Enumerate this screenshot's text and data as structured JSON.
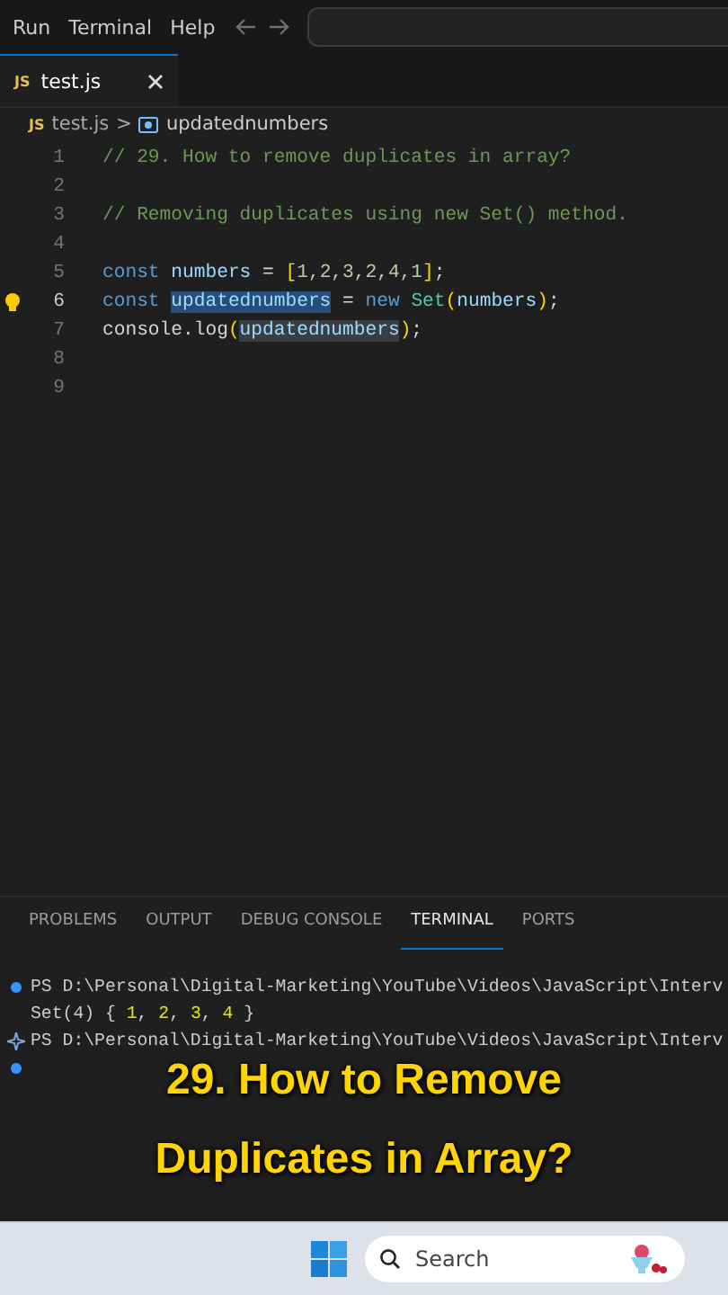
{
  "menu_bar": {
    "items": [
      "Run",
      "Terminal",
      "Help"
    ]
  },
  "tabs": [
    {
      "label": "test.js",
      "file_icon": "JS",
      "selected": true
    }
  ],
  "breadcrumb": {
    "file_icon": "JS",
    "file": "test.js",
    "separator": ">",
    "symbol": "updatednumbers"
  },
  "editor": {
    "lines": [
      {
        "number": "1",
        "current": false,
        "lightbulb": false,
        "tokens": [
          {
            "kind": "comment",
            "text": "// 29. How to remove duplicates in array?"
          }
        ]
      },
      {
        "number": "2",
        "current": false,
        "lightbulb": false
      },
      {
        "number": "3",
        "current": false,
        "lightbulb": false,
        "tokens": [
          {
            "kind": "comment",
            "text": "// Removing duplicates using new Set() method."
          }
        ]
      },
      {
        "number": "4",
        "current": false,
        "lightbulb": false
      },
      {
        "number": "5",
        "current": false,
        "lightbulb": false,
        "tokens": [
          {
            "kind": "keyword",
            "text": "const "
          },
          {
            "kind": "variable",
            "text": "numbers"
          },
          {
            "kind": "plain",
            "text": " = "
          },
          {
            "kind": "bracket",
            "text": "["
          },
          {
            "kind": "number",
            "text": "1,2,3,2,4,1"
          },
          {
            "kind": "bracket",
            "text": "]"
          },
          {
            "kind": "plain",
            "text": ";"
          }
        ]
      },
      {
        "number": "6",
        "current": true,
        "lightbulb": true,
        "tokens": [
          {
            "kind": "keyword",
            "text": "const "
          },
          {
            "kind": "variable",
            "text": "updatednumbers",
            "selection": true
          },
          {
            "kind": "plain",
            "text": " = "
          },
          {
            "kind": "keyword",
            "text": "new "
          },
          {
            "kind": "class",
            "text": "Set"
          },
          {
            "kind": "bracket",
            "text": "("
          },
          {
            "kind": "variable",
            "text": "numbers"
          },
          {
            "kind": "bracket",
            "text": ")"
          },
          {
            "kind": "plain",
            "text": ";"
          }
        ]
      },
      {
        "number": "7",
        "current": false,
        "lightbulb": false,
        "tokens": [
          {
            "kind": "plain",
            "text": "console.log"
          },
          {
            "kind": "bracket",
            "text": "("
          },
          {
            "kind": "variable",
            "text": "updatednumbers",
            "occurrence": true
          },
          {
            "kind": "bracket",
            "text": ")"
          },
          {
            "kind": "plain",
            "text": ";"
          }
        ]
      },
      {
        "number": "8",
        "current": false,
        "lightbulb": false
      },
      {
        "number": "9",
        "current": false,
        "lightbulb": false
      }
    ]
  },
  "panel": {
    "tabs": [
      {
        "label": "PROBLEMS",
        "selected": false
      },
      {
        "label": "OUTPUT",
        "selected": false
      },
      {
        "label": "DEBUG CONSOLE",
        "selected": false
      },
      {
        "label": "TERMINAL",
        "selected": true
      },
      {
        "label": "PORTS",
        "selected": false
      }
    ],
    "terminal_lines": [
      {
        "kind": "dot",
        "tokens": [
          {
            "kind": "plain",
            "text": "PS D:\\Personal\\Digital-Marketing\\YouTube\\Videos\\JavaScript\\Interv"
          }
        ]
      },
      {
        "kind": "none",
        "tokens": [
          {
            "kind": "plain",
            "text": "Set(4) { "
          },
          {
            "kind": "number",
            "text": "1"
          },
          {
            "kind": "plain",
            "text": ", "
          },
          {
            "kind": "number",
            "text": "2"
          },
          {
            "kind": "plain",
            "text": ", "
          },
          {
            "kind": "number",
            "text": "3"
          },
          {
            "kind": "plain",
            "text": ", "
          },
          {
            "kind": "number",
            "text": "4"
          },
          {
            "kind": "plain",
            "text": " }"
          }
        ]
      },
      {
        "kind": "sparkle",
        "tokens": [
          {
            "kind": "plain",
            "text": "PS D:\\Personal\\Digital-Marketing\\YouTube\\Videos\\JavaScript\\Interv"
          }
        ]
      },
      {
        "kind": "dot"
      }
    ]
  },
  "caption": [
    "29. How to Remove",
    "Duplicates in Array?"
  ],
  "taskbar": {
    "search": {
      "placeholder": "Search"
    }
  }
}
